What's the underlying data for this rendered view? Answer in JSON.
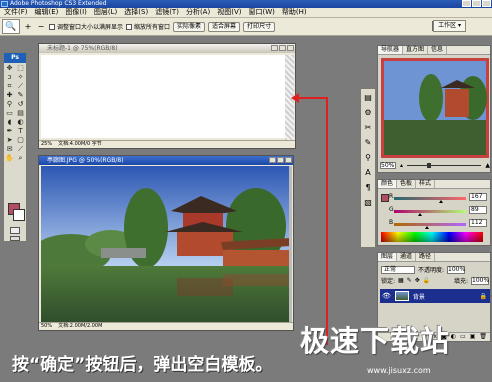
{
  "app": {
    "title": "Adobe Photoshop CS3 Extended"
  },
  "menu": [
    "文件(F)",
    "编辑(E)",
    "图像(I)",
    "图层(L)",
    "选择(S)",
    "滤镜(T)",
    "分析(A)",
    "视图(V)",
    "窗口(W)",
    "帮助(H)"
  ],
  "options": {
    "zoom_in": "+",
    "zoom_out": "−",
    "check1": "调整窗口大小以满屏显示",
    "check2": "缩放所有窗口",
    "btn_actual": "实际像素",
    "btn_fit": "适合屏幕",
    "btn_print": "打印尺寸",
    "workspace": "工作区 ▾"
  },
  "doc_blank": {
    "title": "未标题-1 @ 75%(RGB/8)",
    "zoom": "25%",
    "status": "文档:4.00M/0 字节"
  },
  "doc_photo": {
    "title": "亭廊图.JPG @ 50%(RGB/8)",
    "zoom": "50%",
    "status": "文档:2.00M/2.00M"
  },
  "navigator": {
    "tabs": [
      "导航器",
      "直方图",
      "信息"
    ],
    "zoom": "50%"
  },
  "color": {
    "tabs": [
      "颜色",
      "色板",
      "样式"
    ],
    "R": "167",
    "G": "89",
    "B": "112",
    "fg_color": "#b14c63"
  },
  "layers": {
    "tabs": [
      "图层",
      "通道",
      "路径"
    ],
    "mode": "正常",
    "opacity_label": "不透明度:",
    "opacity": "100%",
    "lock_label": "锁定:",
    "fill_label": "填充:",
    "fill": "100%",
    "layer_name": "背景"
  },
  "caption": "按“确定”按钮后，弹出空白模板。",
  "watermark": {
    "brand": "极速下载站",
    "url": "www.jisuxz.com"
  },
  "colors": {
    "accent": "#e02020",
    "titlebar": "#1a46a0",
    "workspace": "#7b7b7b"
  }
}
